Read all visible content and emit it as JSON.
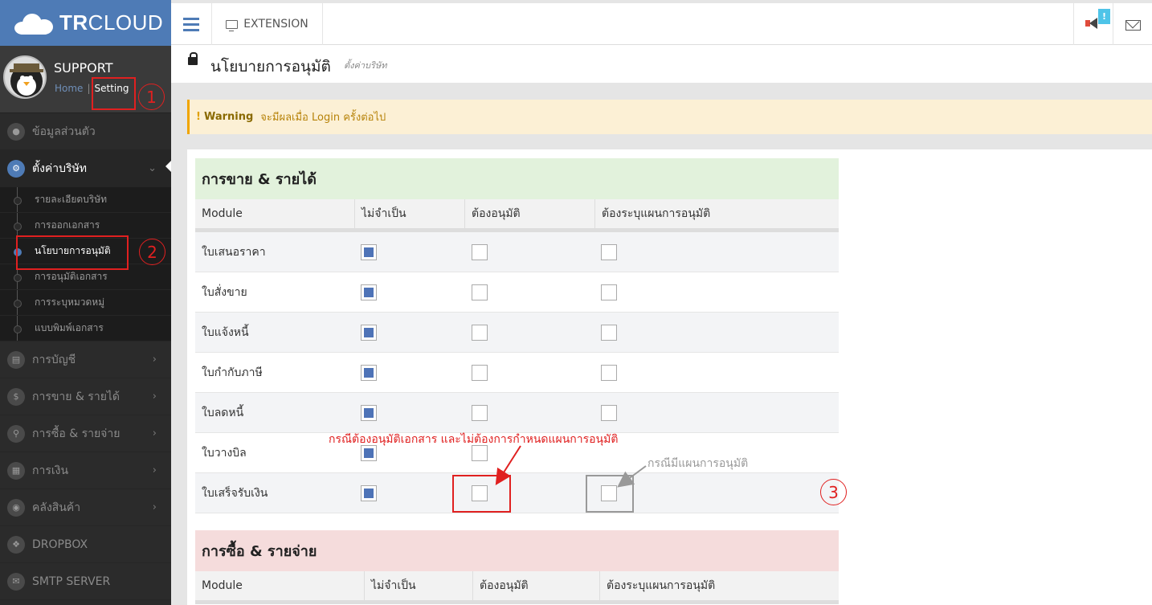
{
  "brand": {
    "bold": "TR",
    "rest": "CLOUD"
  },
  "profile": {
    "name": "SUPPORT",
    "home": "Home",
    "sep": "|",
    "setting": "Setting"
  },
  "sidebar": {
    "items_top": [
      {
        "label": "ข้อมูลส่วนตัว",
        "icon": "user-icon"
      },
      {
        "label": "ตั้งค่าบริษัท",
        "icon": "gear-icon"
      }
    ],
    "submenu": [
      "รายละเอียดบริษัท",
      "การออกเอกสาร",
      "นโยบายการอนุมัติ",
      "การอนุมัติเอกสาร",
      "การระบุหมวดหมู่",
      "แบบพิมพ์เอกสาร"
    ],
    "items_bottom": [
      {
        "label": "การบัญชี",
        "icon": "book-icon"
      },
      {
        "label": "การขาย & รายได้",
        "icon": "dollar-icon"
      },
      {
        "label": "การซื้อ & รายจ่าย",
        "icon": "cart-icon"
      },
      {
        "label": "การเงิน",
        "icon": "calendar-icon"
      },
      {
        "label": "คลังสินค้า",
        "icon": "cube-icon"
      },
      {
        "label": "DROPBOX",
        "icon": "dropbox-icon"
      },
      {
        "label": "SMTP SERVER",
        "icon": "envelope-icon"
      }
    ]
  },
  "topbar": {
    "extension": "EXTENSION",
    "badge": "!"
  },
  "page": {
    "title": "นโยบายการอนุมัติ",
    "subtitle": "ตั้งค่าบริษัท"
  },
  "warning": {
    "icon": "!",
    "label": "Warning",
    "text": "จะมีผลเมื่อ Login ครั้งต่อไป"
  },
  "sales_table": {
    "title": "การขาย & รายได้",
    "header_color": "#e2f2dc",
    "columns": [
      "Module",
      "ไม่จำเป็น",
      "ต้องอนุมัติ",
      "ต้องระบุแผนการอนุมัติ"
    ],
    "rows": [
      {
        "name": "ใบเสนอราคา",
        "values": [
          true,
          false,
          false
        ]
      },
      {
        "name": "ใบสั่งขาย",
        "values": [
          true,
          false,
          false
        ]
      },
      {
        "name": "ใบแจ้งหนี้",
        "values": [
          true,
          false,
          false
        ]
      },
      {
        "name": "ใบกำกับภาษี",
        "values": [
          true,
          false,
          false
        ]
      },
      {
        "name": "ใบลดหนี้",
        "values": [
          true,
          false,
          false
        ]
      },
      {
        "name": "ใบวางบิล",
        "values": [
          true,
          false,
          false
        ]
      },
      {
        "name": "ใบเสร็จรับเงิน",
        "values": [
          true,
          false,
          false
        ]
      }
    ]
  },
  "purchase_table": {
    "title": "การซื้อ & รายจ่าย",
    "header_color": "#f5dcdc",
    "columns": [
      "Module",
      "ไม่จำเป็น",
      "ต้องอนุมัติ",
      "ต้องระบุแผนการอนุมัติ"
    ]
  },
  "annotations": {
    "n1": "1",
    "n2": "2",
    "n3": "3",
    "red_note": "กรณีต้องอนุมัติเอกสาร และไม่ต้องการกำหนดแผนการอนุมัติ",
    "gray_note": "กรณีมีแผนการอนุมัติ"
  },
  "colors": {
    "brand": "#4e7bb6",
    "sidebar": "#2b2b2b",
    "annotation": "#e02020",
    "checked": "#4e73b7"
  }
}
